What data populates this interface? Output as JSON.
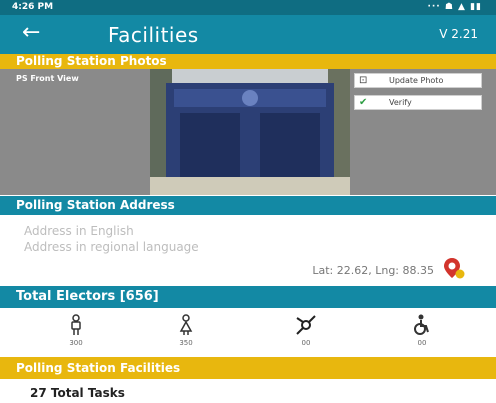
{
  "status_bar": {
    "time": "4:26 PM",
    "indicators": "··· ☗ ▲ ▮▮"
  },
  "app_bar": {
    "back_icon": "arrow-left-icon",
    "title": "Facilities",
    "version": "V 2.21"
  },
  "photos": {
    "header": "Polling Station Photos",
    "label": "PS Front View",
    "update_label": "Update Photo",
    "verify_label": "Verify"
  },
  "address": {
    "header": "Polling Station Address",
    "english_placeholder": "Address in English",
    "regional_placeholder": "Address in regional language",
    "latlng": "Lat: 22.62, Lng: 88.35"
  },
  "electors": {
    "header": "Total Electors [656]",
    "groups": [
      {
        "icon": "male-voter-icon",
        "count": "300"
      },
      {
        "icon": "female-voter-icon",
        "count": "350"
      },
      {
        "icon": "third-gender-icon",
        "count": "00"
      },
      {
        "icon": "disabled-voter-icon",
        "count": "00"
      }
    ]
  },
  "facilities": {
    "header": "Polling Station Facilities",
    "tasks": "27 Total Tasks"
  },
  "colors": {
    "primary": "#1389a4",
    "accent": "#e8b70e",
    "statusbar": "#0f6d82"
  }
}
